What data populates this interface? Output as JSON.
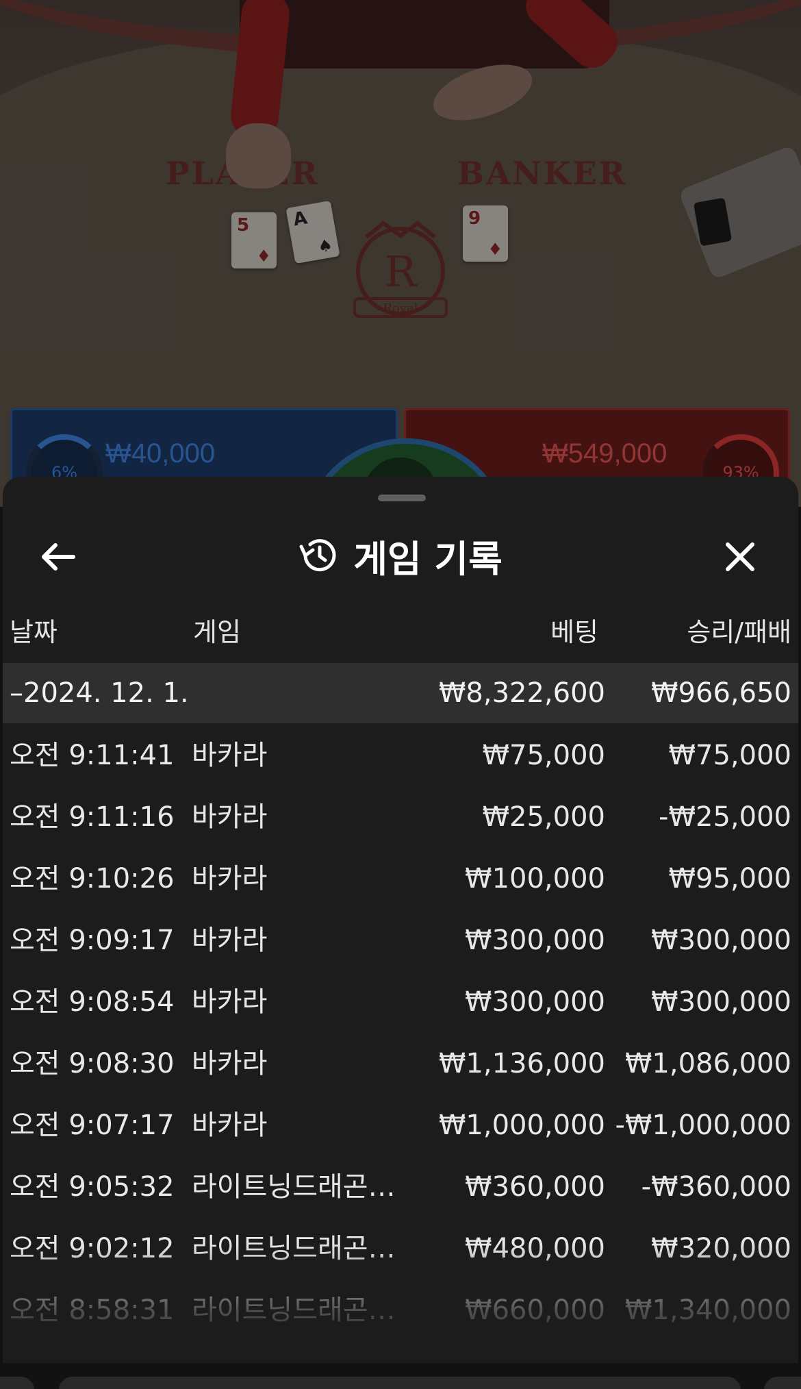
{
  "video": {
    "player_label": "PLAYER",
    "banker_label": "BANKER",
    "crest_letter": "R",
    "crest_text": "Royal",
    "player_percent": "6%",
    "banker_percent": "93%",
    "player_bet": "₩40,000",
    "banker_bet": "₩549,000",
    "cards": [
      {
        "rank": "5",
        "suit": "♦",
        "color": "red"
      },
      {
        "rank": "A",
        "suit": "♠",
        "color": "black"
      },
      {
        "rank": "9",
        "suit": "♦",
        "color": "red"
      }
    ],
    "colors": {
      "player": "#3e82e0",
      "banker": "#e05252",
      "tie": "#235b2f"
    }
  },
  "sheet": {
    "title": "게임 기록",
    "icons": {
      "back": "arrow-left-icon",
      "history": "history-icon",
      "close": "close-icon"
    },
    "columns": {
      "date": "날짜",
      "game": "게임",
      "bet": "베팅",
      "result": "승리/패배"
    },
    "day": {
      "date": "–2024. 12. 1.",
      "bet": "₩8,322,600",
      "result": "₩966,650"
    },
    "rows": [
      {
        "time": "오전 9:11:41",
        "game": "바카라",
        "bet": "₩75,000",
        "result": "₩75,000"
      },
      {
        "time": "오전 9:11:16",
        "game": "바카라",
        "bet": "₩25,000",
        "result": "-₩25,000"
      },
      {
        "time": "오전 9:10:26",
        "game": "바카라",
        "bet": "₩100,000",
        "result": "₩95,000"
      },
      {
        "time": "오전 9:09:17",
        "game": "바카라",
        "bet": "₩300,000",
        "result": "₩300,000"
      },
      {
        "time": "오전 9:08:54",
        "game": "바카라",
        "bet": "₩300,000",
        "result": "₩300,000"
      },
      {
        "time": "오전 9:08:30",
        "game": "바카라",
        "bet": "₩1,136,000",
        "result": "₩1,086,000"
      },
      {
        "time": "오전 9:07:17",
        "game": "바카라",
        "bet": "₩1,000,000",
        "result": "-₩1,000,000"
      },
      {
        "time": "오전 9:05:32",
        "game": "라이트닝드래곤타...",
        "bet": "₩360,000",
        "result": "-₩360,000"
      },
      {
        "time": "오전 9:02:12",
        "game": "라이트닝드래곤타...",
        "bet": "₩480,000",
        "result": "₩320,000"
      },
      {
        "time": "오전 8:58:31",
        "game": "라이트닝드래곤타...",
        "bet": "₩660,000",
        "result": "₩1,340,000"
      }
    ]
  }
}
